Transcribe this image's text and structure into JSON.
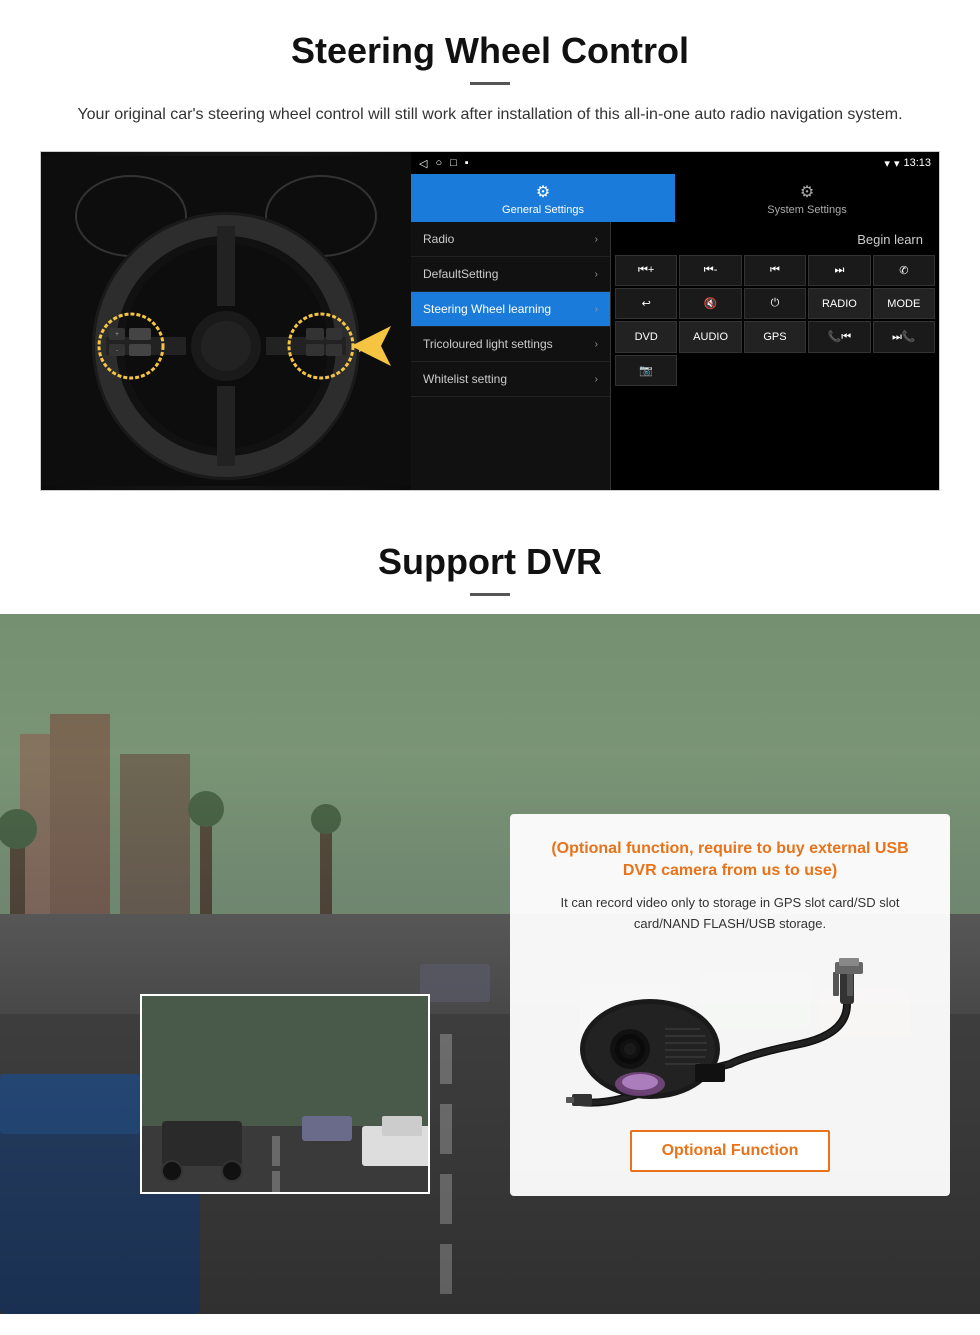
{
  "page": {
    "steering_section": {
      "title": "Steering Wheel Control",
      "description": "Your original car's steering wheel control will still work after installation of this all-in-one auto radio navigation system.",
      "android_ui": {
        "status_bar": {
          "time": "13:13",
          "nav_back": "◁",
          "nav_home": "○",
          "nav_recent": "□",
          "nav_menu": "▪"
        },
        "tabs": [
          {
            "id": "general",
            "label": "General Settings",
            "active": true
          },
          {
            "id": "system",
            "label": "System Settings",
            "active": false
          }
        ],
        "menu_items": [
          {
            "label": "Radio",
            "active": false
          },
          {
            "label": "DefaultSetting",
            "active": false
          },
          {
            "label": "Steering Wheel learning",
            "active": true
          },
          {
            "label": "Tricoloured light settings",
            "active": false
          },
          {
            "label": "Whitelist setting",
            "active": false
          }
        ],
        "begin_learn_label": "Begin learn",
        "control_buttons": [
          {
            "label": "⏮+",
            "row": 1
          },
          {
            "label": "⏮-",
            "row": 1
          },
          {
            "label": "⏮⏮",
            "row": 1
          },
          {
            "label": "⏭⏭",
            "row": 1
          },
          {
            "label": "✆",
            "row": 1
          },
          {
            "label": "↩",
            "row": 2
          },
          {
            "label": "🔇",
            "row": 2
          },
          {
            "label": "⏻",
            "row": 2
          },
          {
            "label": "RADIO",
            "row": 2
          },
          {
            "label": "MODE",
            "row": 2
          },
          {
            "label": "DVD",
            "row": 3
          },
          {
            "label": "AUDIO",
            "row": 3
          },
          {
            "label": "GPS",
            "row": 3
          },
          {
            "label": "📞⏮",
            "row": 3
          },
          {
            "label": "⏭📞",
            "row": 3
          },
          {
            "label": "📷",
            "row": 4
          }
        ]
      }
    },
    "dvr_section": {
      "title": "Support DVR",
      "optional_title": "(Optional function, require to buy external USB DVR camera from us to use)",
      "description": "It can record video only to storage in GPS slot card/SD slot card/NAND FLASH/USB storage.",
      "optional_button_label": "Optional Function"
    }
  }
}
